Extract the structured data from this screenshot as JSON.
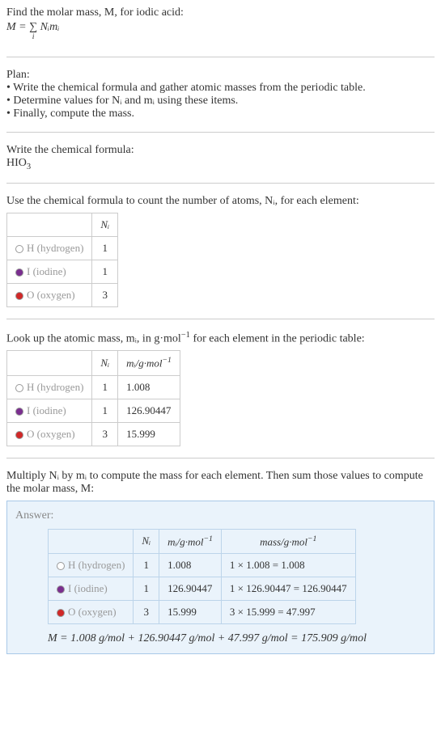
{
  "intro": {
    "line1": "Find the molar mass, M, for iodic acid:",
    "formula_lhs": "M = ",
    "formula_sum": "∑",
    "formula_sum_sub": "i",
    "formula_rhs": " Nᵢmᵢ"
  },
  "plan": {
    "heading": "Plan:",
    "bullets": [
      "• Write the chemical formula and gather atomic masses from the periodic table.",
      "• Determine values for Nᵢ and mᵢ using these items.",
      "• Finally, compute the mass."
    ]
  },
  "chemformula": {
    "heading": "Write the chemical formula:",
    "formula_main": "HIO",
    "formula_sub": "3"
  },
  "count": {
    "heading": "Use the chemical formula to count the number of atoms, Nᵢ, for each element:",
    "col_n": "Nᵢ",
    "rows": [
      {
        "swatch": "#ffffff",
        "label": "H (hydrogen)",
        "n": "1"
      },
      {
        "swatch": "#7a2e8f",
        "label": "I (iodine)",
        "n": "1"
      },
      {
        "swatch": "#d02828",
        "label": "O (oxygen)",
        "n": "3"
      }
    ]
  },
  "lookup": {
    "heading_pre": "Look up the atomic mass, mᵢ, in g·mol",
    "heading_sup": "−1",
    "heading_post": " for each element in the periodic table:",
    "col_n": "Nᵢ",
    "col_m_pre": "mᵢ/g·mol",
    "col_m_sup": "−1",
    "rows": [
      {
        "swatch": "#ffffff",
        "label": "H (hydrogen)",
        "n": "1",
        "m": "1.008"
      },
      {
        "swatch": "#7a2e8f",
        "label": "I (iodine)",
        "n": "1",
        "m": "126.90447"
      },
      {
        "swatch": "#d02828",
        "label": "O (oxygen)",
        "n": "3",
        "m": "15.999"
      }
    ]
  },
  "multiply": {
    "heading": "Multiply Nᵢ by mᵢ to compute the mass for each element. Then sum those values to compute the molar mass, M:"
  },
  "answer": {
    "label": "Answer:",
    "col_n": "Nᵢ",
    "col_m_pre": "mᵢ/g·mol",
    "col_m_sup": "−1",
    "col_mass_pre": "mass/g·mol",
    "col_mass_sup": "−1",
    "rows": [
      {
        "swatch": "#ffffff",
        "label": "H (hydrogen)",
        "n": "1",
        "m": "1.008",
        "mass": "1 × 1.008 = 1.008"
      },
      {
        "swatch": "#7a2e8f",
        "label": "I (iodine)",
        "n": "1",
        "m": "126.90447",
        "mass": "1 × 126.90447 = 126.90447"
      },
      {
        "swatch": "#d02828",
        "label": "O (oxygen)",
        "n": "3",
        "m": "15.999",
        "mass": "3 × 15.999 = 47.997"
      }
    ],
    "final": "M = 1.008 g/mol + 126.90447 g/mol + 47.997 g/mol = 175.909 g/mol"
  }
}
